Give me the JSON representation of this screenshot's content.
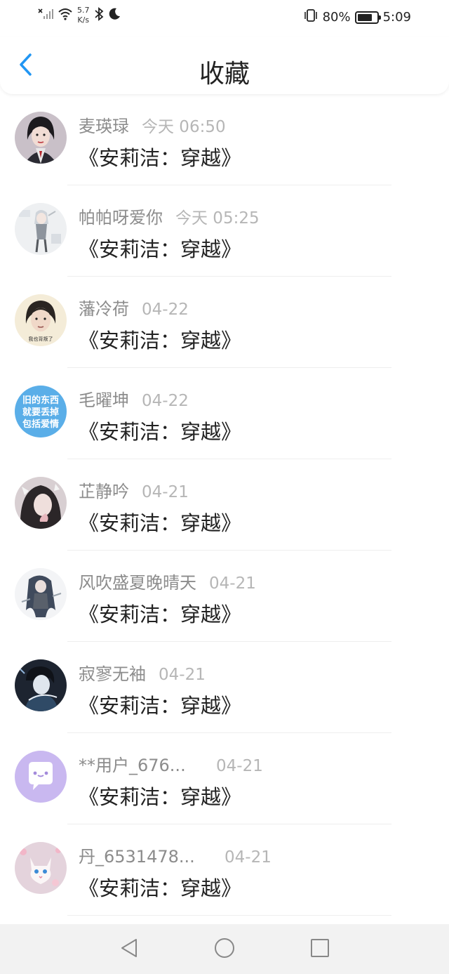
{
  "status_bar": {
    "speed_value": "5.7",
    "speed_unit": "K/s",
    "battery_percent": "80%",
    "battery_level": 0.8,
    "time": "5:09",
    "icons": [
      "signal-off-icon",
      "wifi-icon",
      "bluetooth-icon",
      "moon-icon",
      "vibrate-icon",
      "battery-icon"
    ]
  },
  "header": {
    "title": "收藏",
    "back_icon": "chevron-left-icon",
    "accent_color": "#2196f3"
  },
  "items": [
    {
      "username": "麦瑛琭",
      "time": "今天 06:50",
      "title": "《安莉洁：穿越》"
    },
    {
      "username": "帕帕呀爱你",
      "time": "今天 05:25",
      "title": "《安莉洁：穿越》"
    },
    {
      "username": "藩冷荷",
      "time": "04-22",
      "title": "《安莉洁：穿越》",
      "avatar_caption": "我也背叛了"
    },
    {
      "username": "毛曜坤",
      "time": "04-22",
      "title": "《安莉洁：穿越》",
      "avatar_text": [
        "旧的东西",
        "就要丢掉",
        "包括爱情"
      ]
    },
    {
      "username": "芷静吟",
      "time": "04-21",
      "title": "《安莉洁：穿越》"
    },
    {
      "username": "风吹盛夏晚晴天",
      "time": "04-21",
      "title": "《安莉洁：穿越》"
    },
    {
      "username": "寂寥无袖",
      "time": "04-21",
      "title": "《安莉洁：穿越》"
    },
    {
      "username": "**用户_676...",
      "time": "04-21",
      "title": "《安莉洁：穿越》"
    },
    {
      "username": "丹_6531478...",
      "time": "04-21",
      "title": "《安莉洁：穿越》"
    }
  ],
  "nav_bar": {
    "icons": [
      "back-triangle-icon",
      "home-circle-icon",
      "recents-square-icon"
    ]
  }
}
